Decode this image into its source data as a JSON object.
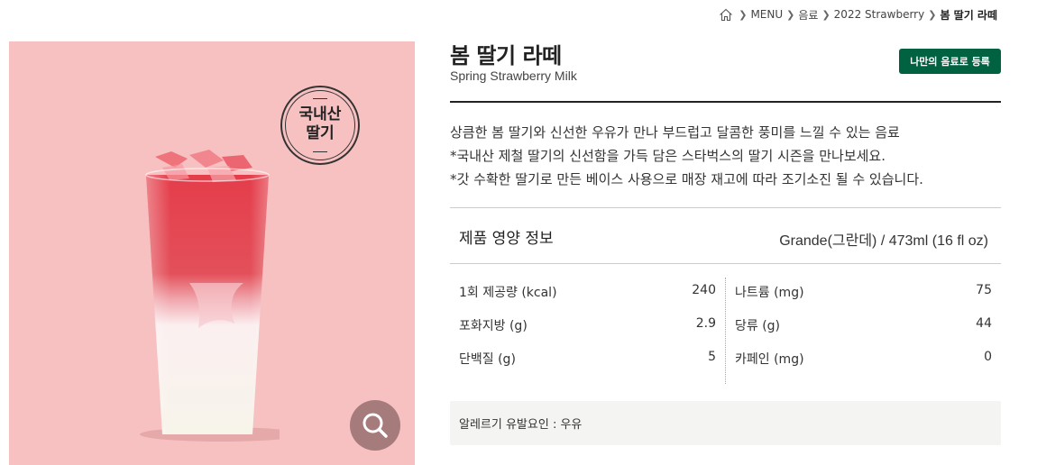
{
  "breadcrumb": {
    "items": [
      "MENU",
      "음료",
      "2022 Strawberry"
    ],
    "current": "봄 딸기 라떼"
  },
  "product": {
    "image_badge_lines": [
      "국내산",
      "딸기"
    ],
    "name": "봄 딸기 라떼",
    "english_name": "Spring Strawberry Milk",
    "favorite_button": "나만의 음료로 등록",
    "description": [
      "상큼한 봄 딸기와 신선한 우유가 만나 부드럽고 달콤한 풍미를 느낄 수 있는 음료",
      "*국내산 제철 딸기의 신선함을 가득 담은 스타벅스의 딸기 시즌을 만나보세요.",
      "*갓 수확한 딸기로 만든 베이스 사용으로 매장 재고에 따라 조기소진 될 수 있습니다."
    ]
  },
  "nutrition": {
    "title": "제품 영양 정보",
    "size": "Grande(그란데) / 473ml (16 fl oz)",
    "left": [
      {
        "label": "1회 제공량 (kcal)",
        "value": "240"
      },
      {
        "label": "포화지방 (g)",
        "value": "2.9"
      },
      {
        "label": "단백질 (g)",
        "value": "5"
      }
    ],
    "right": [
      {
        "label": "나트륨 (mg)",
        "value": "75"
      },
      {
        "label": "당류 (g)",
        "value": "44"
      },
      {
        "label": "카페인 (mg)",
        "value": "0"
      }
    ]
  },
  "allergy": "알레르기 유발요인 : 우유",
  "colors": {
    "brand_green": "#006241",
    "image_background": "#f7c0c1",
    "allergy_background": "#f4f4f2"
  },
  "icons": [
    "home-icon",
    "chevron-right-icon",
    "search-icon"
  ]
}
